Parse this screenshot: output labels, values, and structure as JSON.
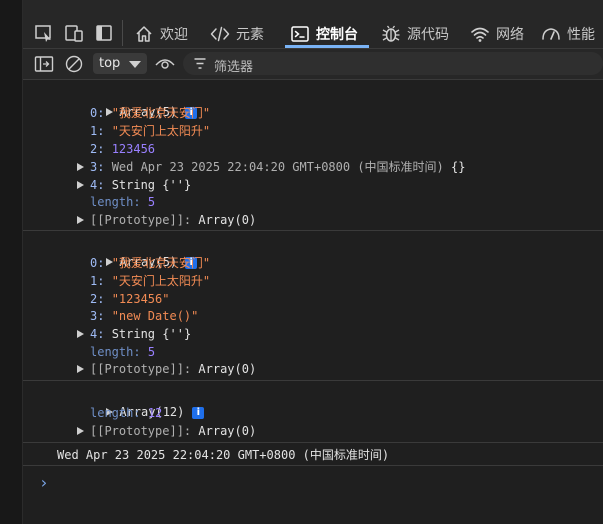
{
  "tabs": [
    {
      "label": "欢迎",
      "icon": "home-icon"
    },
    {
      "label": "元素",
      "icon": "code-icon"
    },
    {
      "label": "控制台",
      "icon": "console-icon"
    },
    {
      "label": "源代码",
      "icon": "bug-icon"
    },
    {
      "label": "网络",
      "icon": "wifi-icon"
    },
    {
      "label": "性能",
      "icon": "performance-icon"
    }
  ],
  "toolbar": {
    "context": "top",
    "filter_placeholder": "筛选器"
  },
  "logs": [
    {
      "summary": "Array(5)",
      "badge": "i",
      "entries": [
        {
          "key": "0:",
          "value": "\"我爱北京天安门\""
        },
        {
          "key": "1:",
          "value": "\"天安门上太阳升\""
        },
        {
          "key": "2:",
          "value": "123456"
        },
        {
          "key": "3:",
          "value": "Wed Apr 23 2025 22:04:20 GMT+0800 (中国标准时间)",
          "suffix": "{}"
        },
        {
          "key": "4:",
          "value": "String",
          "suffix": "{''}"
        },
        {
          "key": "length:",
          "value": "5"
        },
        {
          "key": "[[Prototype]]:",
          "value": "Array(0)"
        }
      ]
    },
    {
      "summary": "Array(5)",
      "badge": "i",
      "entries": [
        {
          "key": "0:",
          "value": "\"我爱北京天安门\""
        },
        {
          "key": "1:",
          "value": "\"天安门上太阳升\""
        },
        {
          "key": "2:",
          "value": "\"123456\""
        },
        {
          "key": "3:",
          "value": "\"new Date()\""
        },
        {
          "key": "4:",
          "value": "String",
          "suffix": "{''}"
        },
        {
          "key": "length:",
          "value": "5"
        },
        {
          "key": "[[Prototype]]:",
          "value": "Array(0)"
        }
      ]
    },
    {
      "summary": "Array(12)",
      "badge": "i",
      "entries": [
        {
          "key": "length:",
          "value": "12"
        },
        {
          "key": "[[Prototype]]:",
          "value": "Array(0)"
        }
      ]
    }
  ],
  "date_output": "Wed Apr 23 2025 22:04:20 GMT+0800 (中国标准时间)",
  "prompt": "›"
}
